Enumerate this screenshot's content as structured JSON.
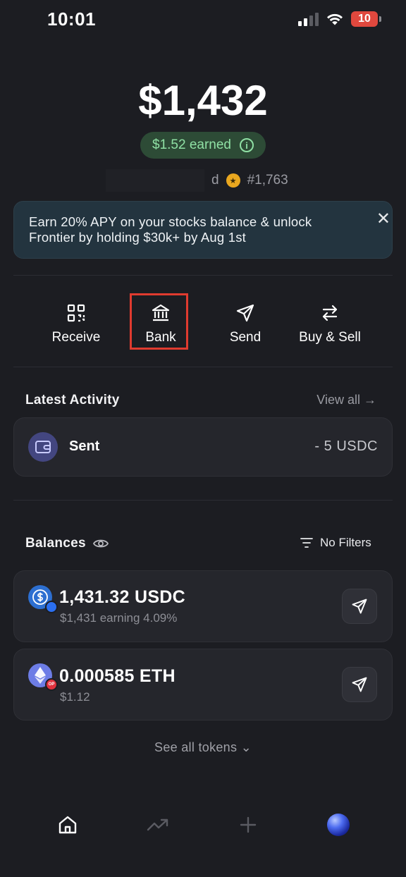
{
  "status_bar": {
    "time": "10:01",
    "battery": "10"
  },
  "balance": {
    "total": "$1,432",
    "earned": "$1.52 earned",
    "username_suffix": "d",
    "rank": "#1,763"
  },
  "promo": {
    "text": "Earn 20% APY on your stocks balance & unlock Frontier by holding $30k+ by Aug 1st",
    "close_icon": "close-icon"
  },
  "actions": [
    {
      "label": "Receive",
      "icon": "qr-code-icon"
    },
    {
      "label": "Bank",
      "icon": "bank-icon"
    },
    {
      "label": "Send",
      "icon": "send-icon"
    },
    {
      "label": "Buy & Sell",
      "icon": "swap-icon"
    }
  ],
  "activity": {
    "title": "Latest Activity",
    "view_all": "View all →",
    "items": [
      {
        "label": "Sent",
        "amount": "- 5 USDC",
        "icon": "wallet-icon"
      }
    ]
  },
  "balances": {
    "title": "Balances",
    "filter_label": "No Filters",
    "tokens": [
      {
        "name": "1,431.32 USDC",
        "sub": "$1,431 earning 4.09%",
        "icon": "usdc-icon",
        "badge_color": "#2b6ff0"
      },
      {
        "name": "0.000585 ETH",
        "sub": "$1.12",
        "icon": "eth-icon",
        "badge_color": "#e0313d"
      }
    ],
    "see_all": "See all tokens ⌄"
  },
  "nav": [
    {
      "icon": "home-icon"
    },
    {
      "icon": "trending-icon"
    },
    {
      "icon": "plus-icon"
    },
    {
      "icon": "profile-globe-icon"
    }
  ],
  "colors": {
    "background": "#1c1d22",
    "accent_green": "#8fe0a4",
    "highlight_red": "#e03b2f",
    "card": "#25262c"
  }
}
